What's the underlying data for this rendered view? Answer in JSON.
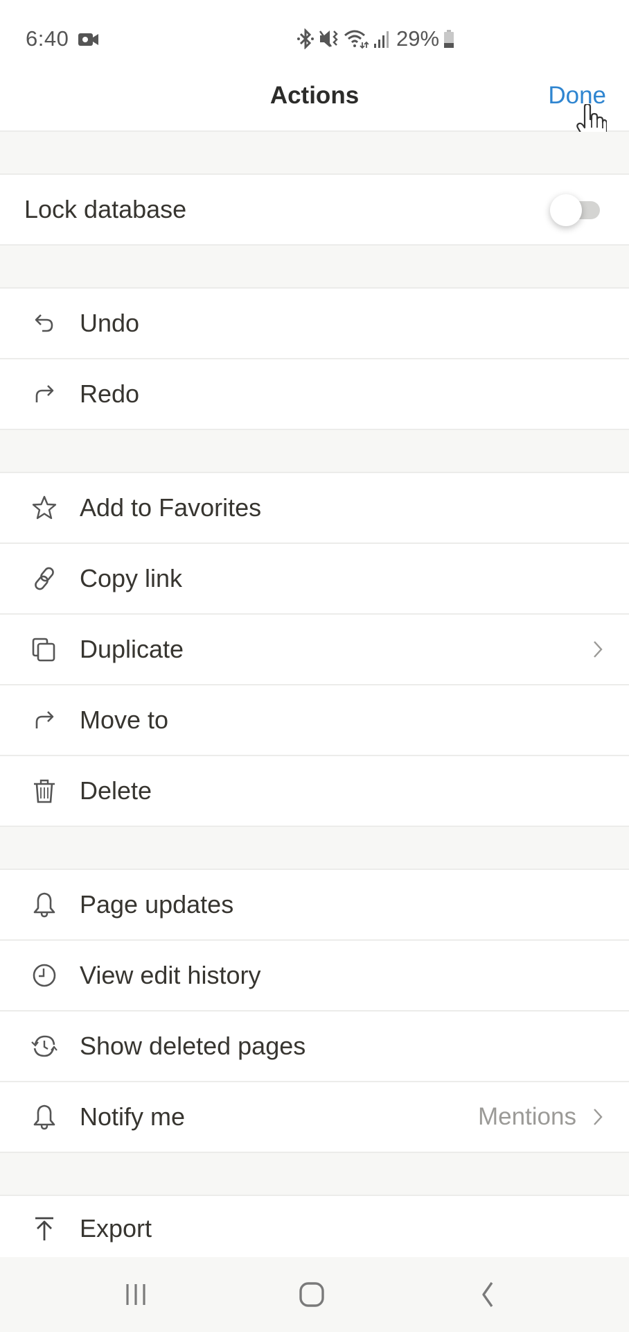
{
  "status_bar": {
    "time": "6:40",
    "battery_percent": "29%",
    "icons": [
      "video-recording-icon",
      "bluetooth-icon",
      "mute-vibrate-icon",
      "wifi-icon",
      "signal-icon",
      "battery-icon"
    ]
  },
  "header": {
    "title": "Actions",
    "done_label": "Done"
  },
  "colors": {
    "accent": "#2f85d0",
    "text": "#373530",
    "secondary_text": "#9b9a97",
    "group_gap": "#f7f7f5",
    "divider": "#ececea"
  },
  "groups": [
    {
      "items": [
        {
          "label": "Lock database",
          "control": "toggle",
          "toggle_on": false
        }
      ]
    },
    {
      "items": [
        {
          "label": "Undo",
          "icon": "undo-icon"
        },
        {
          "label": "Redo",
          "icon": "redo-icon"
        }
      ]
    },
    {
      "items": [
        {
          "label": "Add to Favorites",
          "icon": "star-icon"
        },
        {
          "label": "Copy link",
          "icon": "link-icon"
        },
        {
          "label": "Duplicate",
          "icon": "duplicate-icon",
          "chevron": true
        },
        {
          "label": "Move to",
          "icon": "move-arrow-icon"
        },
        {
          "label": "Delete",
          "icon": "trash-icon"
        }
      ]
    },
    {
      "items": [
        {
          "label": "Page updates",
          "icon": "bell-icon"
        },
        {
          "label": "View edit history",
          "icon": "clock-icon"
        },
        {
          "label": "Show deleted pages",
          "icon": "restore-history-icon"
        },
        {
          "label": "Notify me",
          "icon": "bell-icon",
          "value": "Mentions",
          "chevron": true
        }
      ]
    },
    {
      "items": [
        {
          "label": "Export",
          "icon": "export-icon"
        }
      ]
    }
  ],
  "nav_bar": {
    "buttons": [
      "recent-apps",
      "home",
      "back"
    ]
  }
}
